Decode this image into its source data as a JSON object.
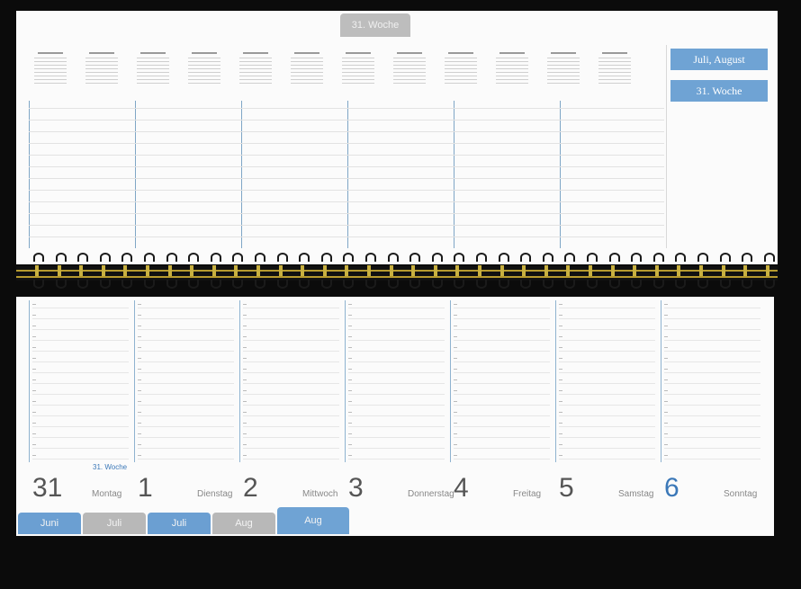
{
  "planner": {
    "top_tab_label": "31. Woche",
    "month_badge": "Juli, August",
    "week_badge": "31. Woche",
    "week_label_small": "31. Woche",
    "days": [
      {
        "num": "31",
        "name": "Montag",
        "sunday": false
      },
      {
        "num": "1",
        "name": "Dienstag",
        "sunday": false
      },
      {
        "num": "2",
        "name": "Mittwoch",
        "sunday": false
      },
      {
        "num": "3",
        "name": "Donnerstag",
        "sunday": false
      },
      {
        "num": "4",
        "name": "Freitag",
        "sunday": false
      },
      {
        "num": "5",
        "name": "Samstag",
        "sunday": false
      },
      {
        "num": "6",
        "name": "Sonntag",
        "sunday": true
      }
    ],
    "tabs": [
      {
        "label": "Juni",
        "color": "#6b9fd2",
        "active": false
      },
      {
        "label": "Juli",
        "color": "#b8b8b8",
        "active": false
      },
      {
        "label": "Juli",
        "color": "#6b9fd2",
        "active": false
      },
      {
        "label": "Aug",
        "color": "#b8b8b8",
        "active": false
      },
      {
        "label": "Aug",
        "color": "#6fa3d4",
        "active": true
      }
    ]
  },
  "colors": {
    "accent": "#6fa3d4",
    "sunday": "#3b78b8",
    "binding_gold": "#b69a2e"
  }
}
